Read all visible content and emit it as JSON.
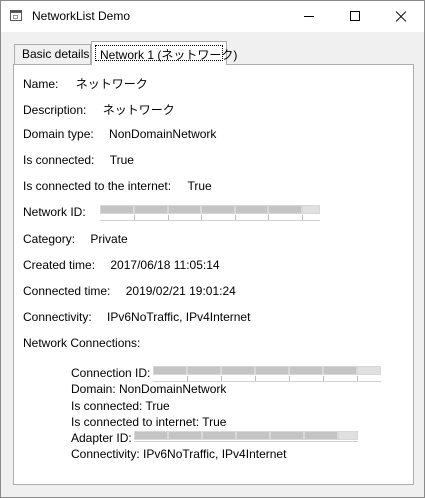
{
  "window": {
    "title": "NetworkList Demo"
  },
  "tabs": [
    {
      "label": "Basic details",
      "selected": false
    },
    {
      "label": "Network 1 (ネットワーク)",
      "selected": true
    }
  ],
  "network": {
    "name_label": "Name:",
    "name_value": "ネットワーク",
    "description_label": "Description:",
    "description_value": "ネットワーク",
    "domain_type_label": "Domain type:",
    "domain_type_value": "NonDomainNetwork",
    "is_connected_label": "Is connected:",
    "is_connected_value": "True",
    "internet_label": "Is connected to the internet:",
    "internet_value": "True",
    "network_id_label": "Network ID:",
    "category_label": "Category:",
    "category_value": "Private",
    "created_label": "Created time:",
    "created_value": "2017/06/18 11:05:14",
    "connected_time_label": "Connected time:",
    "connected_time_value": "2019/02/21 19:01:24",
    "connectivity_label": "Connectivity:",
    "connectivity_value": "IPv6NoTraffic, IPv4Internet",
    "connections_label": "Network Connections:"
  },
  "connection": {
    "connection_id_label": "Connection ID:",
    "domain_line": "Domain: NonDomainNetwork",
    "is_connected_line": "Is connected: True",
    "internet_line": "Is connected to internet: True",
    "adapter_id_label": "Adapter ID:",
    "connectivity_line": "Connectivity: IPv6NoTraffic, IPv4Internet"
  },
  "icons": {
    "app": "window-app-icon",
    "minimize": "minimize-icon",
    "maximize": "maximize-icon",
    "close": "close-icon"
  }
}
